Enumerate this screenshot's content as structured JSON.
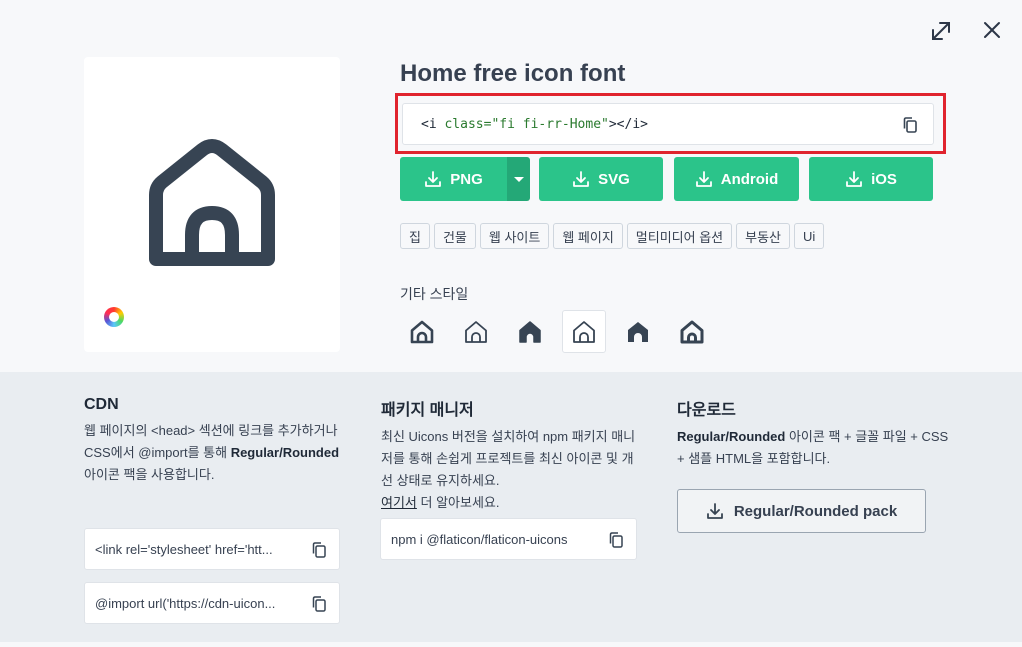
{
  "modal": {
    "title": "Home free icon font",
    "code": {
      "open": "<i ",
      "attr": "class=",
      "value": "\"fi fi-rr-Home\"",
      "close": "></i>"
    },
    "buttons": {
      "png": "PNG",
      "svg": "SVG",
      "android": "Android",
      "ios": "iOS"
    },
    "tags": [
      "집",
      "건물",
      "웹 사이트",
      "웹 페이지",
      "멀티미디어 옵션",
      "부동산",
      "Ui"
    ],
    "other_styles_label": "기타 스타일",
    "other_styles": [
      "regular-rounded",
      "regular-straight",
      "solid-rounded",
      "regular-active",
      "solid-straight",
      "bold-rounded"
    ]
  },
  "cdn": {
    "title": "CDN",
    "desc_1": "웹 페이지의 <head> 섹션에 링크를 추가하거나 CSS에서 @import를 통해 ",
    "desc_bold": "Regular/Rounded",
    "desc_2": " 아이콘 팩을 사용합니다.",
    "link_snippet": "<link rel='stylesheet' href='htt...",
    "import_snippet": "@import url('https://cdn-uicon..."
  },
  "package_manager": {
    "title": "패키지 매니저",
    "desc": "최신 Uicons 버전을 설치하여 npm 패키지 매니저를 통해 손쉽게 프로젝트를 최신 아이콘 및 개선 상태로 유지하세요.",
    "link_text": "여기서",
    "link_suffix": " 더 알아보세요.",
    "npm_snippet": "npm i @flaticon/flaticon-uicons"
  },
  "download": {
    "title": "다운로드",
    "desc_bold": "Regular/Rounded",
    "desc": " 아이콘 팩 + 글꼴 파일 + CSS + 샘플 HTML을 포함합니다.",
    "pack_button": "Regular/Rounded pack"
  },
  "colors": {
    "accent": "#2bc48a",
    "accent_dark": "#24a877",
    "highlight": "#e0242e",
    "icon": "#374453"
  }
}
